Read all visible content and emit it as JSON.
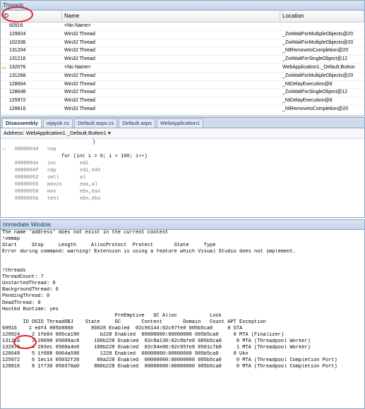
{
  "threads": {
    "title": "Threads",
    "columns": [
      "ID",
      "Name",
      "Location"
    ],
    "rows": [
      {
        "id": "60916",
        "name": "<No Name>",
        "location": "",
        "current": false
      },
      {
        "id": "129924",
        "name": "Win32 Thread",
        "location": "_ZwWaitForMultipleObjects@20",
        "current": false
      },
      {
        "id": "102336",
        "name": "Win32 Thread",
        "location": "_ZwWaitForMultipleObjects@20",
        "current": false
      },
      {
        "id": "131204",
        "name": "Win32 Thread",
        "location": "_NtRemoveIoCompletion@20",
        "current": false
      },
      {
        "id": "131216",
        "name": "Win32 Thread",
        "location": "_ZwWaitForSingleObject@12",
        "current": false
      },
      {
        "id": "132076",
        "name": "<No Name>",
        "location": "WebApplication1._Default.Button",
        "current": true
      },
      {
        "id": "131268",
        "name": "Win32 Thread",
        "location": "_ZwWaitForMultipleObjects@20",
        "current": false
      },
      {
        "id": "128664",
        "name": "Win32 Thread",
        "location": "_NtDelayExecution@8",
        "current": false
      },
      {
        "id": "128648",
        "name": "Win32 Thread",
        "location": "_ZwWaitForSingleObject@12",
        "current": false
      },
      {
        "id": "125972",
        "name": "Win32 Thread",
        "location": "_NtDelayExecution@8",
        "current": false
      },
      {
        "id": "128816",
        "name": "Win32 Thread",
        "location": "_NtRemoveIoCompletion@20",
        "current": false
      }
    ]
  },
  "disassembly": {
    "tabs": [
      "Disassembly",
      "vijaysk.cs",
      "Default.aspx.cs",
      "Default.aspx",
      "WebApplication1"
    ],
    "address_label": "Address:",
    "address_value": "WebApplication1._Default.Button1",
    "lines": [
      {
        "addr": "",
        "op": "",
        "arg": "}",
        "src": true
      },
      {
        "addr": "0000004d",
        "op": "nop",
        "arg": "",
        "src": false
      },
      {
        "addr": "",
        "op": "",
        "arg": "for (int i = 0; i < 100; i++)",
        "src": true
      },
      {
        "addr": "0000004e",
        "op": "inc",
        "arg": "edi",
        "src": false
      },
      {
        "addr": "0000004f",
        "op": "cmp",
        "arg": "edi,64h",
        "src": false
      },
      {
        "addr": "00000052",
        "op": "setl",
        "arg": "al",
        "src": false
      },
      {
        "addr": "00000055",
        "op": "movzx",
        "arg": "eax,al",
        "src": false
      },
      {
        "addr": "00000058",
        "op": "mov",
        "arg": "ebx,eax",
        "src": false
      },
      {
        "addr": "0000005a",
        "op": "test",
        "arg": "ebx,ebx",
        "src": false
      }
    ]
  },
  "immediate": {
    "title": "Immediate Window",
    "lines": [
      "The name 'address' does not exist in the current context",
      "!vmmap",
      "Start     Stop     Length     AllocProtect  Protect       State     Type",
      "Error during command: warning! Extension is using a feature which Visual Studio does not implement.",
      "",
      "",
      "!threads",
      "ThreadCount: 7",
      "UnstartedThread: 0",
      "BackgroundThread: 6",
      "PendingThread: 0",
      "DeadThread: 0",
      "Hosted Runtime: yes",
      "                                      PreEmptive   GC Alloc           Lock",
      "       ID OSID ThreadOBJ    State     GC       Context       Domain   Count APT Exception",
      "60916    1 edf4 005b9860      86028 Enabled  02c96144:02c97fe8 005b5ca0     0 STA",
      "129924    2 1fb84 005ca190       b228 Enabled  00000000:00000000 005b5ca0     0 MTA (Finalizer)",
      "131216    3 20090 05009ac8     180b228 Enabled  02c8a130:02c8bfe8 005b5ca0     0 MTA (Threadpool Worker)",
      "132076    4 203ec 0500a4e0     188b228 Enabled  02c94e00:02c95fe8 0501c7b8     1 MTA (Threadpool Worker)",
      "128648    5 1f688 0064a598       1228 Enabled  00000000:00000000 005b5ca0     0 Ukn",
      "125972    6 1ec14 05032f20      80a228 Enabled  00000000:00000000 005b5ca0     0 MTA (Threadpool Completion Port)",
      "128816    8 1f730 050378a0     880b228 Enabled  00000000:00000000 005b5ca0     0 MTA (Threadpool Completion Port)"
    ]
  },
  "colors": {
    "highlight_oval": "#e0202a",
    "current_thread_arrow": "#e5b300",
    "pane_border": "#8ea4c0"
  }
}
